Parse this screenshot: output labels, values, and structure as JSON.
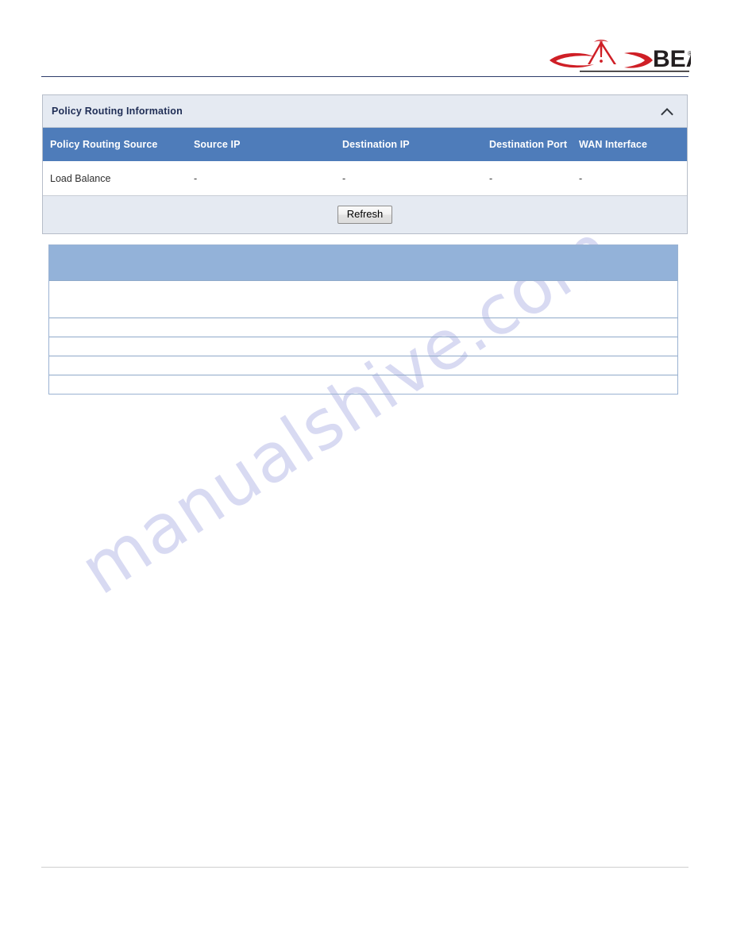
{
  "page": {
    "brand": {
      "logo_name": "beam-logo",
      "logo_text": "BEAM",
      "logo_trademark": "®",
      "logo_color": "#cf1f26",
      "wordmark_color": "#231f20"
    },
    "watermark": "manualshive.com",
    "watermark_color": "#b9bce8"
  },
  "panel": {
    "title": "Policy Routing Information",
    "collapse_icon": "chevron-up-icon",
    "title_color": "#1f2d55",
    "header_bg": "#e5eaf2",
    "accent_blue": "#4e7cba"
  },
  "table": {
    "columns": [
      "Policy Routing Source",
      "Source IP",
      "Destination IP",
      "Destination Port",
      "WAN Interface"
    ],
    "rows": [
      [
        "Load Balance",
        "-",
        "-",
        "-",
        "-"
      ]
    ]
  },
  "footer": {
    "refresh_label": "Refresh"
  },
  "table2": {
    "header_bg": "#93b2d9",
    "border_color": "#9ab2d2",
    "header_cells": [
      "",
      "",
      ""
    ],
    "rows": [
      [
        "",
        "",
        ""
      ],
      [
        "",
        "",
        ""
      ],
      [
        "",
        "",
        ""
      ],
      [
        "",
        "",
        ""
      ],
      [
        "",
        "",
        ""
      ]
    ]
  }
}
